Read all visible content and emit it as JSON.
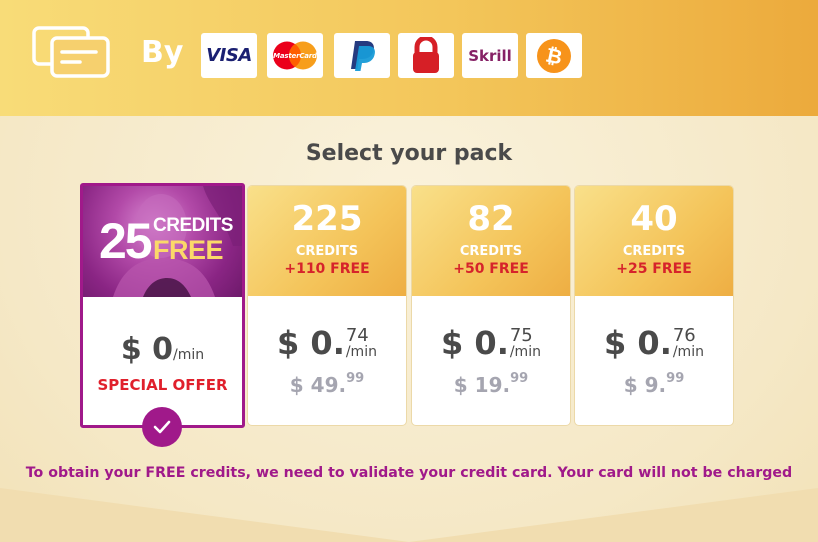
{
  "header": {
    "by_label": "By",
    "payment_methods": [
      {
        "name": "Visa",
        "label": "VISA",
        "icon": "visa-logo"
      },
      {
        "name": "MasterCard",
        "label": "MasterCard",
        "icon": "mastercard-logo"
      },
      {
        "name": "PayPal",
        "icon": "paypal-logo"
      },
      {
        "name": "Lock",
        "icon": "lock-logo"
      },
      {
        "name": "Skrill",
        "label": "Skrill",
        "icon": "skrill-logo"
      },
      {
        "name": "Bitcoin",
        "icon": "bitcoin-logo"
      }
    ]
  },
  "title": "Select your pack",
  "offer_pack": {
    "credits": "25",
    "credits_word": "CREDITS",
    "free_word": "FREE",
    "price": "$ 0",
    "per_min": "/min",
    "special_label": "SPECIAL OFFER",
    "selected": true
  },
  "packs": [
    {
      "credits": "225",
      "credits_label": "CREDITS",
      "bonus": "+110 FREE",
      "price_int": "$ 0.",
      "price_dec": "74",
      "per_min": "/min",
      "total_int": "$ 49.",
      "total_dec": "99"
    },
    {
      "credits": "82",
      "credits_label": "CREDITS",
      "bonus": "+50 FREE",
      "price_int": "$ 0.",
      "price_dec": "75",
      "per_min": "/min",
      "total_int": "$ 19.",
      "total_dec": "99"
    },
    {
      "credits": "40",
      "credits_label": "CREDITS",
      "bonus": "+25 FREE",
      "price_int": "$ 0.",
      "price_dec": "76",
      "per_min": "/min",
      "total_int": "$ 9.",
      "total_dec": "99"
    }
  ],
  "notice": "To obtain your FREE credits, we need to validate your credit card. Your card will not be charged",
  "colors": {
    "accent_purple": "#a0198a",
    "offer_red": "#e0202c",
    "header_gold": "#f3c65a"
  }
}
